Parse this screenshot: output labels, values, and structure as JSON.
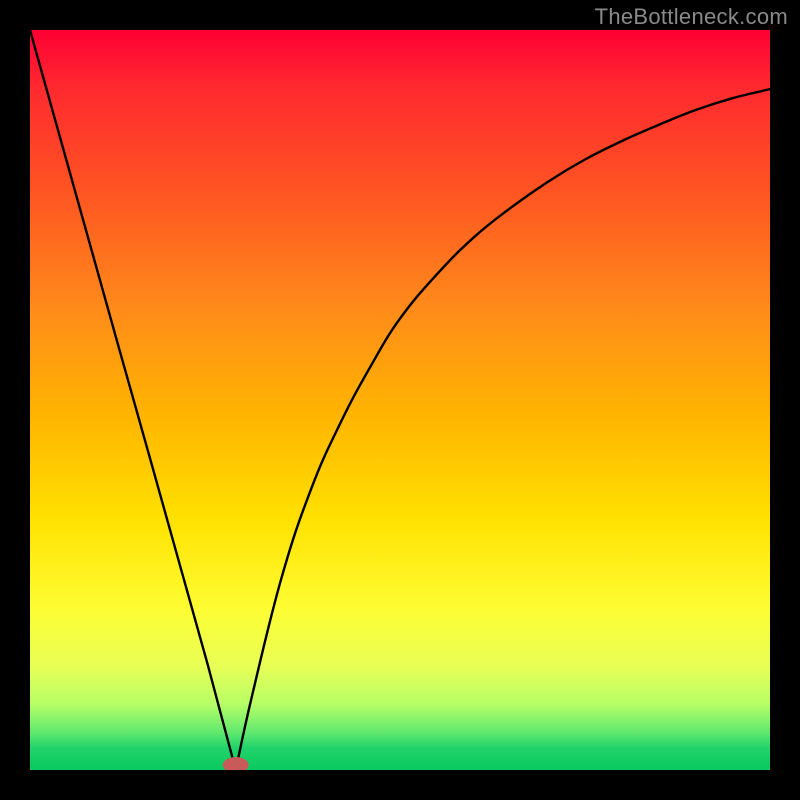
{
  "watermark": "TheBottleneck.com",
  "chart_data": {
    "type": "line",
    "title": "",
    "xlabel": "",
    "ylabel": "",
    "xlim": [
      0,
      1
    ],
    "ylim": [
      0,
      1
    ],
    "x": [
      0.0,
      0.04,
      0.08,
      0.12,
      0.16,
      0.2,
      0.24,
      0.278,
      0.3,
      0.34,
      0.38,
      0.42,
      0.46,
      0.5,
      0.55,
      0.6,
      0.65,
      0.7,
      0.75,
      0.8,
      0.85,
      0.9,
      0.95,
      1.0
    ],
    "values": [
      1.0,
      0.857,
      0.714,
      0.571,
      0.429,
      0.286,
      0.143,
      0.0,
      0.1,
      0.26,
      0.38,
      0.47,
      0.545,
      0.61,
      0.67,
      0.72,
      0.76,
      0.795,
      0.825,
      0.85,
      0.872,
      0.892,
      0.908,
      0.92
    ],
    "minimum_marker": {
      "x": 0.278,
      "y": 0.0
    },
    "gradient_stops": [
      {
        "pos": 0.0,
        "color": "#ff0033"
      },
      {
        "pos": 0.08,
        "color": "#ff2a2f"
      },
      {
        "pos": 0.22,
        "color": "#ff5522"
      },
      {
        "pos": 0.38,
        "color": "#ff8c1a"
      },
      {
        "pos": 0.52,
        "color": "#ffb400"
      },
      {
        "pos": 0.66,
        "color": "#ffe100"
      },
      {
        "pos": 0.78,
        "color": "#fdfd32"
      },
      {
        "pos": 0.86,
        "color": "#e8ff55"
      },
      {
        "pos": 0.91,
        "color": "#b8ff66"
      },
      {
        "pos": 0.95,
        "color": "#5fe86f"
      },
      {
        "pos": 0.97,
        "color": "#22d36b"
      },
      {
        "pos": 1.0,
        "color": "#08c95f"
      }
    ]
  }
}
